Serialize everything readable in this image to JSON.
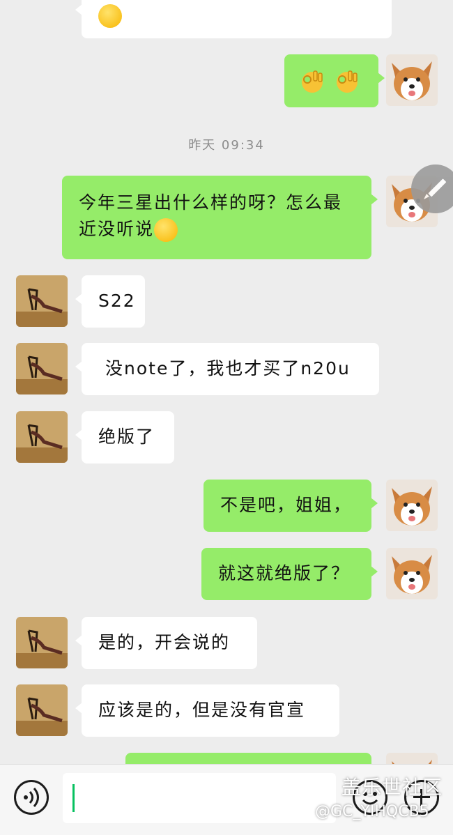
{
  "chat": {
    "timestamp": "昨天 09:34",
    "messages": [
      {
        "sender": "them",
        "text": ""
      },
      {
        "sender": "me",
        "text": "",
        "emoji": [
          "ok-hand",
          "ok-hand"
        ]
      },
      {
        "sender": "me",
        "text_line1": "今年三星出什么样的呀？怎么最",
        "text_line2": "近没听说"
      },
      {
        "sender": "them",
        "text": "S22"
      },
      {
        "sender": "them",
        "text": "没note了，我也才买了n20u"
      },
      {
        "sender": "them",
        "text": "绝版了"
      },
      {
        "sender": "me",
        "text": "不是吧，姐姐，"
      },
      {
        "sender": "me",
        "text": "就这就绝版了？"
      },
      {
        "sender": "them",
        "text": "是的，开会说的"
      },
      {
        "sender": "them",
        "text": "应该是的，但是没有官宣"
      },
      {
        "sender": "me",
        "text": ""
      }
    ]
  },
  "icons": {
    "me_avatar": "corgi-avatar",
    "them_avatar": "yoga-avatar",
    "edit": "pencil-icon",
    "voice": "voice-icon",
    "emoji": "emoji-icon",
    "plus": "plus-icon"
  },
  "colors": {
    "me_bubble": "#95ec69",
    "them_bubble": "#ffffff",
    "background": "#ededed",
    "caret": "#07c160"
  },
  "watermark": {
    "line1": "盖乐世社区",
    "line2": "@GC_YIHQCB5"
  }
}
